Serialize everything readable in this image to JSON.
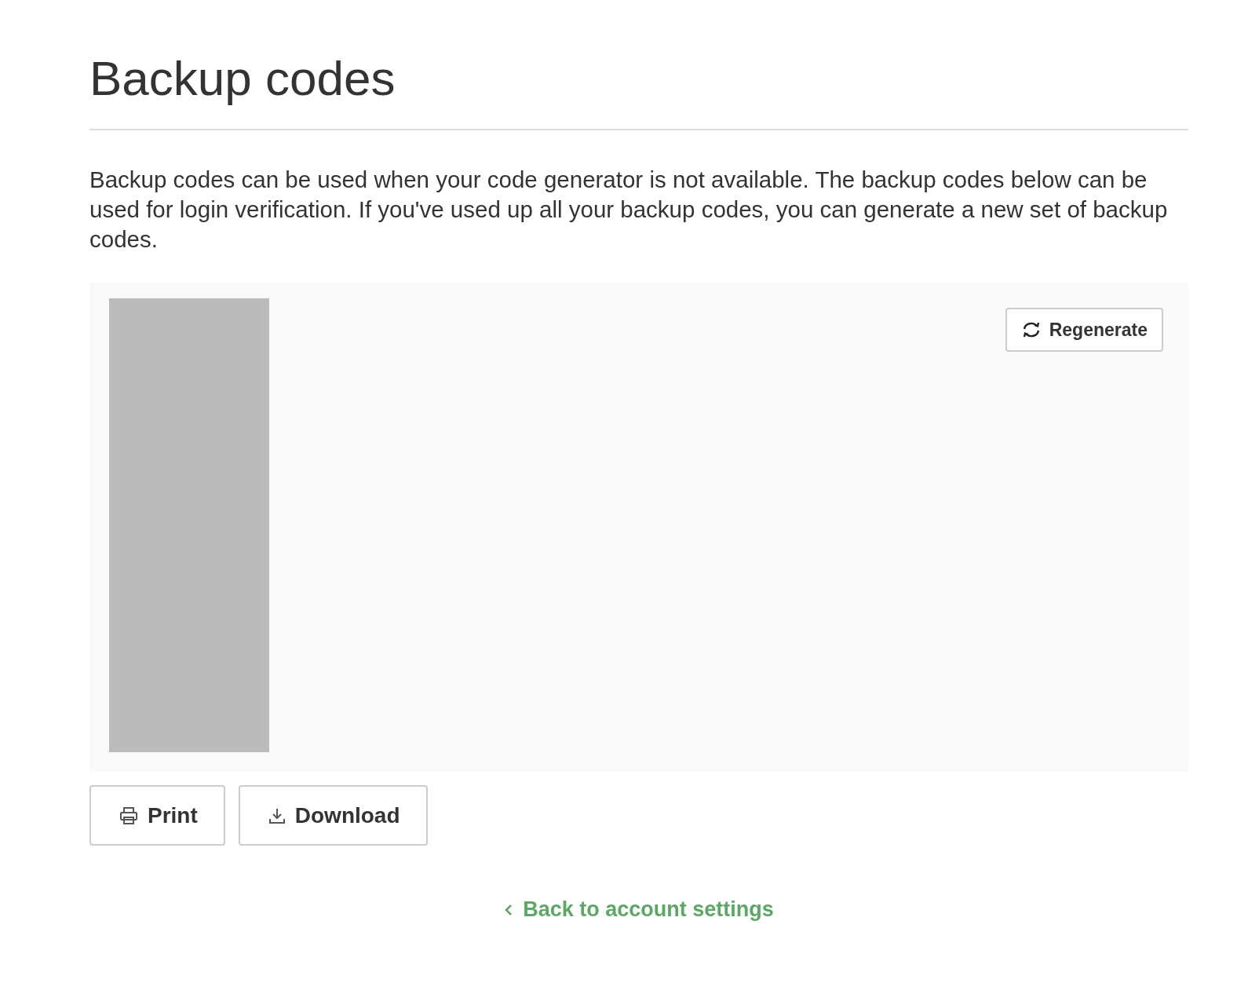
{
  "title": "Backup codes",
  "description": "Backup codes can be used when your code generator is not available. The backup codes below can be used for login verification. If you've used up all your backup codes, you can generate a new set of backup codes.",
  "codes_panel": {
    "regenerate_button": "Regenerate"
  },
  "actions": [
    {
      "kind": "print",
      "label": "Print"
    },
    {
      "kind": "download",
      "label": "Download"
    }
  ],
  "back_link": {
    "label": "Back to account settings"
  }
}
